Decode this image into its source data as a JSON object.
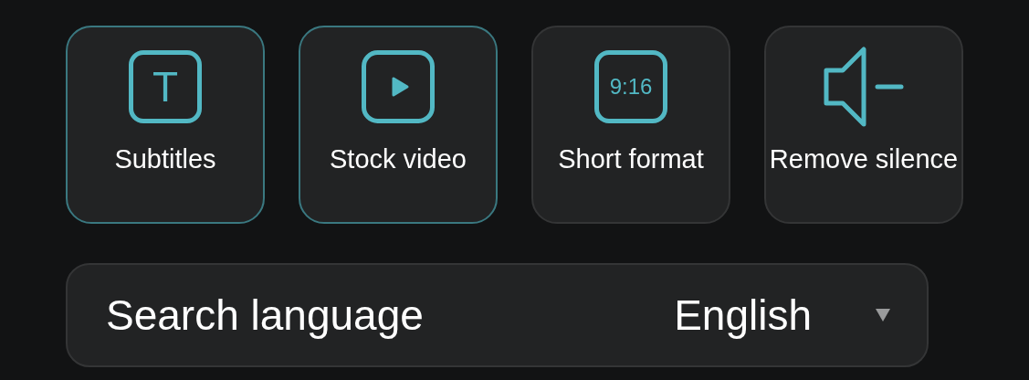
{
  "tools": [
    {
      "kind": "text",
      "icon_text": "T",
      "label": "Subtitles",
      "selected": true
    },
    {
      "kind": "play",
      "label": "Stock video",
      "selected": true
    },
    {
      "kind": "ratio",
      "icon_text": "9:16",
      "label": "Short format",
      "selected": false
    },
    {
      "kind": "speaker",
      "label": "Remove silence",
      "selected": false
    }
  ],
  "language_select": {
    "label": "Search language",
    "value": "English"
  }
}
